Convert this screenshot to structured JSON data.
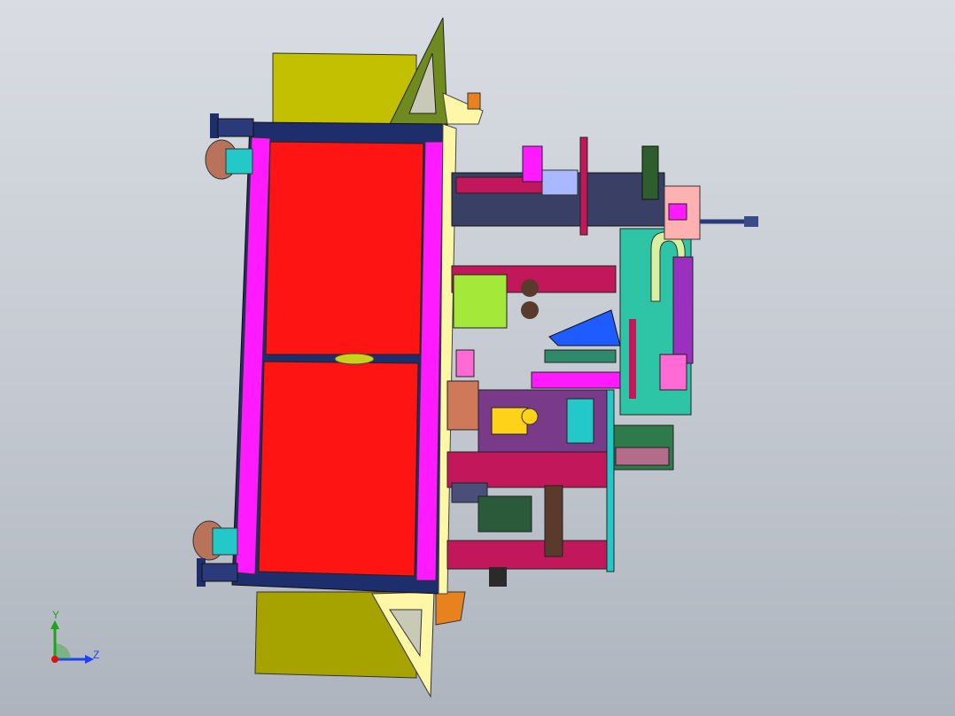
{
  "viewer": {
    "background_top": "#d9dde3",
    "background_bottom": "#aeb4bd"
  },
  "model": {
    "colors": {
      "frame_dark": "#1e2d6b",
      "panel_red": "#ff1414",
      "magenta": "#ff1aff",
      "olive": "#c2c000",
      "green_bracket": "#6f8a1e",
      "cream": "#fff7a8",
      "orange": "#e8821e",
      "pink_rail": "#c2185b",
      "cyan": "#23c9c9",
      "teal_plate": "#2ec4a6",
      "blue_wedge": "#1f5cff",
      "caster": "#b8735a"
    }
  },
  "triad": {
    "y_label": "Y",
    "z_label": "Z",
    "y_color": "#1aa51a",
    "z_color": "#1f3fff",
    "x_color": "#e01010"
  }
}
